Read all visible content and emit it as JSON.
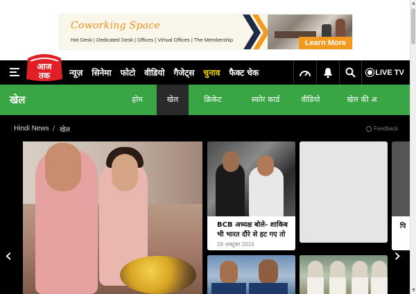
{
  "ad": {
    "title": "Coworking Space",
    "subtitle": "Hot Desk | Dedicated Desk | Offices | Virtual Offices | The Membership",
    "cta": "Learn More"
  },
  "header": {
    "logo_text_top": "आज",
    "logo_text_bottom": "तक",
    "nav": [
      {
        "label": "न्यूज़",
        "highlight": false
      },
      {
        "label": "सिनेमा",
        "highlight": false
      },
      {
        "label": "फोटो",
        "highlight": false
      },
      {
        "label": "वीडियो",
        "highlight": false
      },
      {
        "label": "गैजेट्स",
        "highlight": false
      },
      {
        "label": "चुनाव",
        "highlight": true
      },
      {
        "label": "फैक्ट चेक",
        "highlight": false
      }
    ],
    "live_label": "LIVE TV",
    "icons": [
      "speedometer-icon",
      "bell-icon",
      "search-icon"
    ],
    "highlight_color": "#f5d200"
  },
  "section": {
    "title": "खेल",
    "tabs": [
      "होम",
      "खेल",
      "क्रिकेट",
      "स्कोर कार्ड",
      "वीडियो",
      "खेल की अ"
    ],
    "active_tab": "खेल",
    "color": "#3aa545"
  },
  "breadcrumb": {
    "home": "Hindi News",
    "separator": "/",
    "current": "खेल",
    "feedback": "Feedback"
  },
  "carousel": {
    "cards": [
      {
        "title": "BCB अध्यक्ष बोले- शाकिब भी भारत दौरे से हट गए तो",
        "date": "28 अक्टूबर 2019"
      }
    ],
    "right_card_partial_title": "पि"
  }
}
